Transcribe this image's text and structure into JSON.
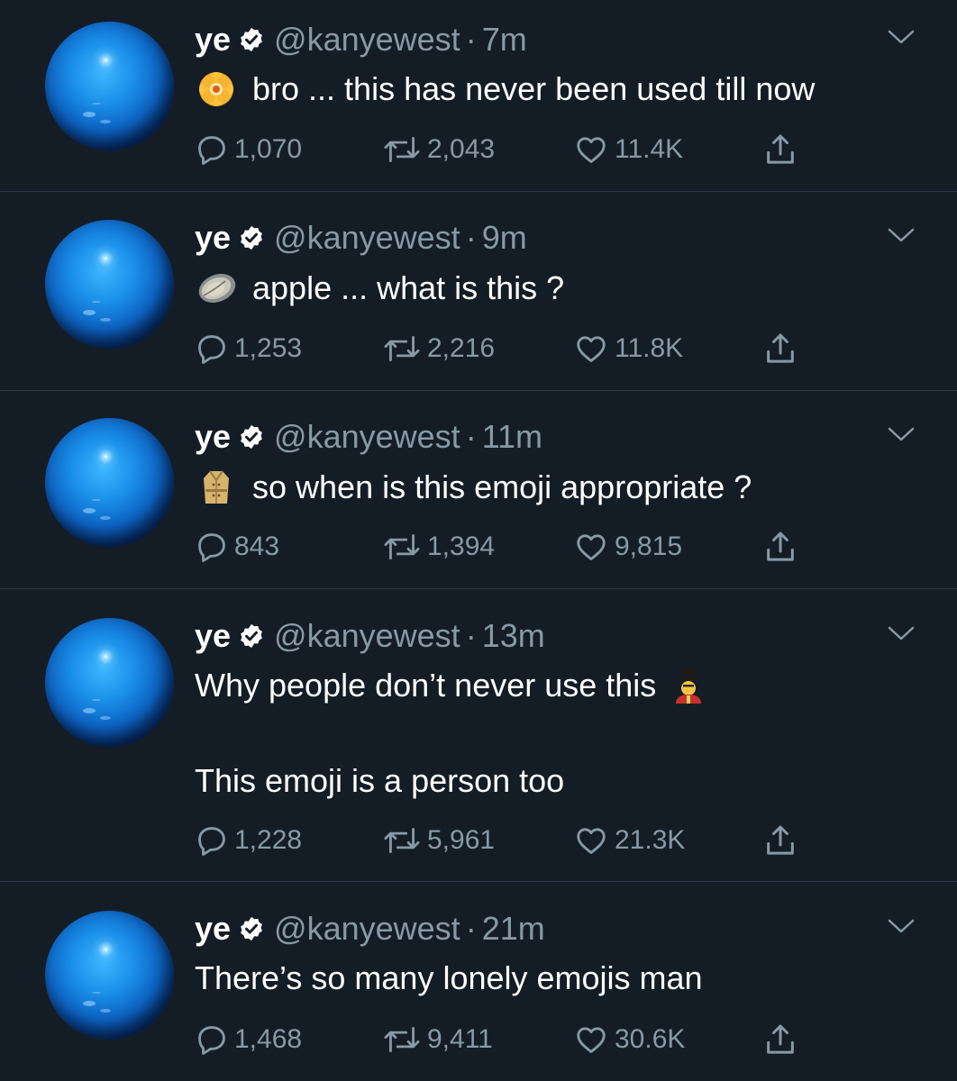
{
  "tweets": [
    {
      "name": "ye",
      "handle": "@kanyewest",
      "separator": "·",
      "time": "7m",
      "emoji": "flower-emoji",
      "lines": [
        "bro ... this has never been used till now"
      ],
      "replies": "1,070",
      "retweets": "2,043",
      "likes": "11.4K"
    },
    {
      "name": "ye",
      "handle": "@kanyewest",
      "separator": "·",
      "time": "9m",
      "emoji": "oyster-emoji",
      "lines": [
        "apple ... what is this ?"
      ],
      "replies": "1,253",
      "retweets": "2,216",
      "likes": "11.8K"
    },
    {
      "name": "ye",
      "handle": "@kanyewest",
      "separator": "·",
      "time": "11m",
      "emoji": "trenchcoat-emoji",
      "lines": [
        "so when is this emoji appropriate ?"
      ],
      "replies": "843",
      "retweets": "1,394",
      "likes": "9,815"
    },
    {
      "name": "ye",
      "handle": "@kanyewest",
      "separator": "·",
      "time": "13m",
      "emoji": "guard-emoji",
      "lines": [
        "Why people don’t never use this",
        "",
        "This emoji is a person too"
      ],
      "replies": "1,228",
      "retweets": "5,961",
      "likes": "21.3K"
    },
    {
      "name": "ye",
      "handle": "@kanyewest",
      "separator": "·",
      "time": "21m",
      "emoji": "",
      "lines": [
        "There’s so many lonely emojis man"
      ],
      "replies": "1,468",
      "retweets": "9,411",
      "likes": "30.6K"
    }
  ],
  "colors": {
    "background": "#141d26",
    "text": "#ffffff",
    "muted": "#8899a6",
    "divider": "#2a3744"
  }
}
